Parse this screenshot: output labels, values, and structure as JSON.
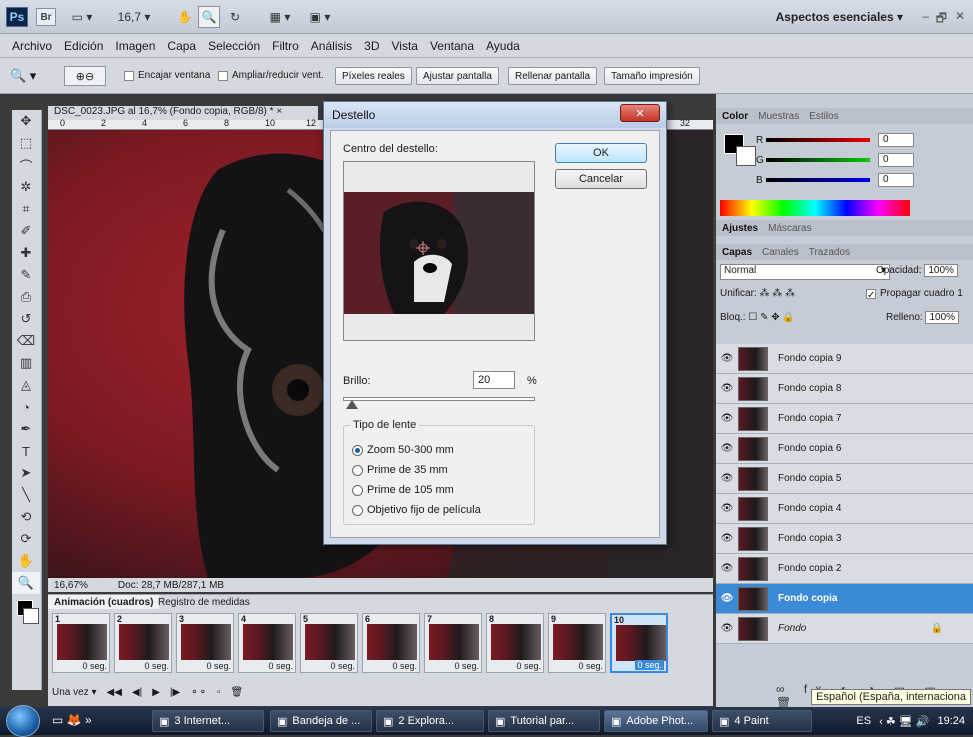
{
  "app": {
    "zoom_label": "16,7",
    "workspace": "Aspectos esenciales",
    "menu": [
      "Archivo",
      "Edición",
      "Imagen",
      "Capa",
      "Selección",
      "Filtro",
      "Análisis",
      "3D",
      "Vista",
      "Ventana",
      "Ayuda"
    ]
  },
  "options": {
    "fit_window": "Encajar ventana",
    "zoom_resize": "Ampliar/reducir vent.",
    "actual_pixels": "Píxeles reales",
    "fit_screen": "Ajustar pantalla",
    "fill_screen": "Rellenar pantalla",
    "print_size": "Tamaño impresión"
  },
  "document": {
    "tab": "DSC_0023.JPG al 16,7% (Fondo copia, RGB/8) *",
    "zoom": "16,67%",
    "doc_size": "Doc: 28,7 MB/287,1 MB",
    "ruler_marks": [
      "0",
      "2",
      "4",
      "6",
      "8",
      "10",
      "12",
      "32"
    ]
  },
  "dialog": {
    "title": "Destello",
    "center_label": "Centro del destello:",
    "ok": "OK",
    "cancel": "Cancelar",
    "brightness_label": "Brillo:",
    "brightness_value": "20",
    "percent": "%",
    "brightness_level": 0.2,
    "lens_group_label": "Tipo de lente",
    "lens_options": [
      "Zoom 50-300 mm",
      "Prime de 35 mm",
      "Prime de 105 mm",
      "Objetivo fijo de película"
    ],
    "selected_lens": 0
  },
  "animation": {
    "tab_active": "Animación (cuadros)",
    "tab_other": "Registro de medidas",
    "frames": [
      {
        "n": "1",
        "dur": "0 seg."
      },
      {
        "n": "2",
        "dur": "0 seg."
      },
      {
        "n": "3",
        "dur": "0 seg."
      },
      {
        "n": "4",
        "dur": "0 seg."
      },
      {
        "n": "5",
        "dur": "0 seg."
      },
      {
        "n": "6",
        "dur": "0 seg."
      },
      {
        "n": "7",
        "dur": "0 seg."
      },
      {
        "n": "8",
        "dur": "0 seg."
      },
      {
        "n": "9",
        "dur": "0 seg."
      },
      {
        "n": "10",
        "dur": "0 seg."
      }
    ],
    "loop": "Una vez"
  },
  "color_panel": {
    "tabs": [
      "Color",
      "Muestras",
      "Estilos"
    ],
    "r": "0",
    "g": "0",
    "b": "0",
    "r_label": "R",
    "g_label": "G",
    "b_label": "B"
  },
  "adjust_panel": {
    "tabs": [
      "Ajustes",
      "Máscaras"
    ]
  },
  "layers_panel": {
    "tabs": [
      "Capas",
      "Canales",
      "Trazados"
    ],
    "blend": "Normal",
    "opacity_label": "Opacidad:",
    "opacity": "100%",
    "unify_label": "Unificar:",
    "propagate": "Propagar cuadro 1",
    "lock_label": "Bloq.:",
    "fill_label": "Relleno:",
    "fill": "100%",
    "layers": [
      "Fondo copia 9",
      "Fondo copia 8",
      "Fondo copia 7",
      "Fondo copia 6",
      "Fondo copia 5",
      "Fondo copia 4",
      "Fondo copia 3",
      "Fondo copia 2",
      "Fondo copia",
      "Fondo"
    ],
    "selected": 8
  },
  "taskbar": {
    "items": [
      "3 Internet...",
      "Bandeja de ...",
      "2 Explora...",
      "Tutorial par...",
      "Adobe Phot...",
      "4 Paint"
    ],
    "lang": "ES",
    "time": "19:24",
    "tooltip": "Español (España, internaciona"
  },
  "colors": {
    "accent": "#3a8ad8",
    "canvas_red": "#8a1e27"
  }
}
